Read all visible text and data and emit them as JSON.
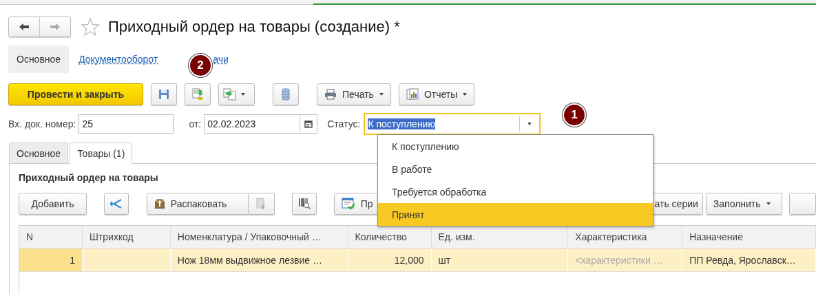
{
  "window": {
    "title": "Приходный ордер на товары (создание) *"
  },
  "form_tabs": [
    {
      "label": "Основное",
      "selected": true
    },
    {
      "label": "Документооборот",
      "selected": false
    },
    {
      "label": "ачи",
      "selected": false
    }
  ],
  "toolbar": {
    "post_close": "Провести и закрыть",
    "print": "Печать",
    "reports": "Отчеты"
  },
  "fields": {
    "number": {
      "label": "Вх. док. номер:",
      "value": "25"
    },
    "date": {
      "label": "от:",
      "value": "02.02.2023"
    },
    "status": {
      "label": "Статус:",
      "value": "К поступлению",
      "text_selected": true,
      "focused": true
    }
  },
  "status_dropdown": {
    "options": [
      {
        "label": "К поступлению",
        "selected": false
      },
      {
        "label": "В работе",
        "selected": false
      },
      {
        "label": "Требуется обработка",
        "selected": false
      },
      {
        "label": "Принят",
        "selected": true
      }
    ]
  },
  "callouts": [
    {
      "number": "2"
    },
    {
      "number": "1"
    }
  ],
  "doc_tabs": [
    {
      "label": "Основное",
      "selected": false
    },
    {
      "label": "Товары (1)",
      "selected": true
    }
  ],
  "panel_title": "Приходный ордер на товары",
  "table_toolbar": {
    "add": "Добавить",
    "unpack": "Распаковать",
    "partial_left": "Пр",
    "partial_right": "ать серии",
    "fill": "Заполнить"
  },
  "table": {
    "columns": [
      "N",
      "Штрихкод",
      "Номенклатура / Упаковочный …",
      "Количество",
      "Ед. изм.",
      "Характеристика",
      "Назначение"
    ],
    "rows": [
      {
        "selected": true,
        "n": "1",
        "nomenclature": "Нож 18мм выдвижное лезвие …",
        "quantity": "12,000",
        "unit": "шт",
        "characteristic_placeholder": "<характеристики …",
        "purpose": "ПП Ревда, Ярославск…"
      }
    ]
  }
}
